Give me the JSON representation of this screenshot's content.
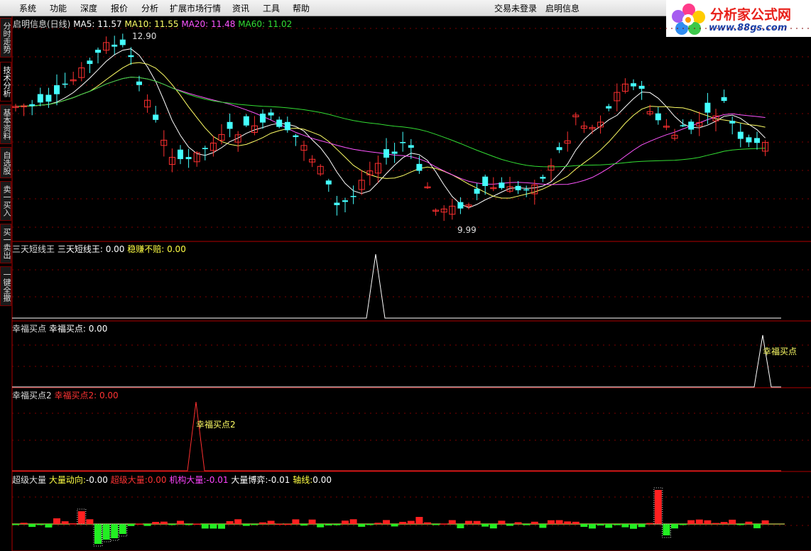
{
  "menu": [
    "系统",
    "功能",
    "深度",
    "报价",
    "分析",
    "扩展市场行情",
    "资讯",
    "工具",
    "帮助"
  ],
  "status": {
    "login": "交易未登录",
    "stock": "启明信息"
  },
  "logo": {
    "title": "分析家公式网",
    "url": "www.88gs.com"
  },
  "side_tabs": [
    "分时走势",
    "技术分析",
    "基本资料",
    "自选股",
    "卖一买入",
    "买一卖出",
    "一键全撤"
  ],
  "main_panel": {
    "title": "启明信息(日线)",
    "ma": [
      {
        "label": "MA5: 11.57",
        "color": "#ffffff"
      },
      {
        "label": "MA10: 11.55",
        "color": "#ffff66"
      },
      {
        "label": "MA20: 11.48",
        "color": "#ff55ff"
      },
      {
        "label": "MA60: 11.02",
        "color": "#33dd33"
      }
    ],
    "high_label": "12.90",
    "low_label": "9.99"
  },
  "panel_sankou": {
    "name": "三天短线王",
    "items": [
      {
        "label": "三天短线王: 0.00",
        "color": "#ffffff"
      },
      {
        "label": "稳赚不赔: 0.00",
        "color": "#ffff44"
      }
    ]
  },
  "panel_xingfu": {
    "name": "幸福买点",
    "items": [
      {
        "label": "幸福买点: 0.00",
        "color": "#ffffff"
      }
    ],
    "signal": "幸福买点"
  },
  "panel_xingfu2": {
    "name": "幸福买点2",
    "items": [
      {
        "label": "幸福买点2: 0.00",
        "color": "#ff3333"
      }
    ],
    "signal": "幸福买点2"
  },
  "panel_volume": {
    "name": "超级大量",
    "items": [
      {
        "label": "大量动向:",
        "value": "-0.00",
        "color": "#ffff44"
      },
      {
        "label": "超级大量:",
        "value": "0.00",
        "color": "#ff3333"
      },
      {
        "label": "机构大量:",
        "value": "-0.01",
        "color": "#ff44ff"
      },
      {
        "label": "大量博弈:",
        "value": "-0.01",
        "color": "#ffffff"
      },
      {
        "label": "轴线:",
        "value": "0.00",
        "color": "#ffff44"
      }
    ]
  },
  "colors": {
    "up": "#ff3030",
    "down": "#44ffff",
    "grid": "#800000",
    "frame": "#b00000"
  }
}
